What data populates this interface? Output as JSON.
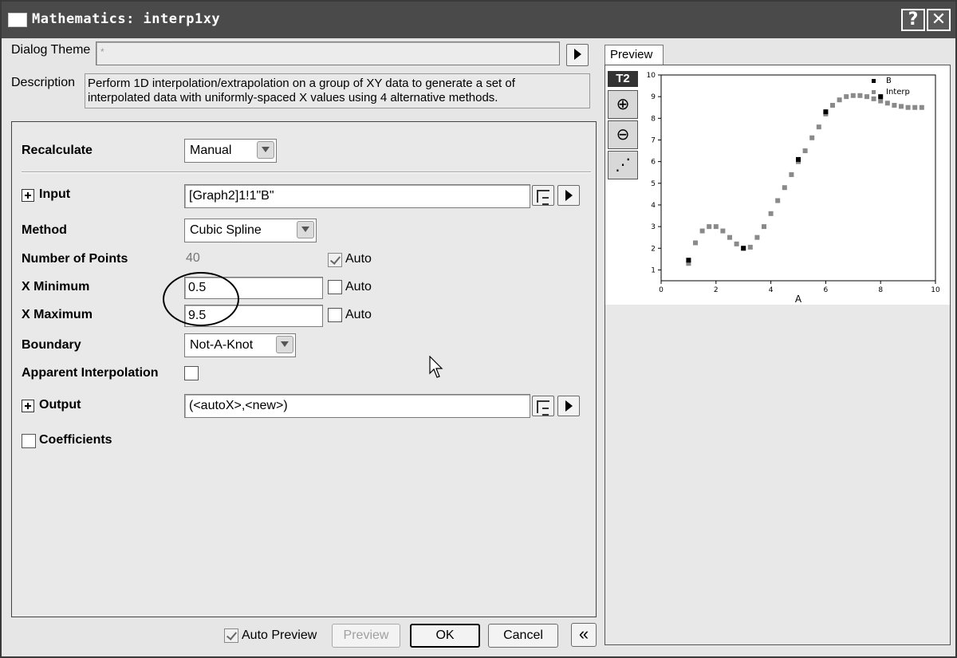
{
  "window": {
    "title": "Mathematics: interp1xy"
  },
  "titlebar": {
    "help_glyph": "?",
    "close_glyph": "✕"
  },
  "dialog_theme": {
    "label": "Dialog Theme",
    "value": "*"
  },
  "description": {
    "label": "Description",
    "text_line1": "Perform 1D interpolation/extrapolation on a group of XY data to generate a set of",
    "text_line2": "interpolated data with uniformly-spaced X values using 4 alternative methods."
  },
  "form": {
    "recalculate": {
      "label": "Recalculate",
      "value": "Manual"
    },
    "input": {
      "label": "Input",
      "value": "[Graph2]1!1\"B\""
    },
    "method": {
      "label": "Method",
      "value": "Cubic Spline"
    },
    "num_points": {
      "label": "Number of Points",
      "value": "40",
      "auto_label": "Auto",
      "auto_checked": true
    },
    "x_min": {
      "label": "X Minimum",
      "value": "0.5",
      "auto_label": "Auto",
      "auto_checked": false
    },
    "x_max": {
      "label": "X Maximum",
      "value": "9.5",
      "auto_label": "Auto",
      "auto_checked": false
    },
    "boundary": {
      "label": "Boundary",
      "value": "Not-A-Knot"
    },
    "apparent": {
      "label": "Apparent  Interpolation",
      "checked": false
    },
    "output": {
      "label": "Output",
      "value": "(<autoX>,<new>)"
    },
    "coefficients": {
      "label": "Coefficients",
      "checked": false
    }
  },
  "footer": {
    "auto_preview_label": "Auto Preview",
    "auto_preview_checked": true,
    "preview_label": "Preview",
    "ok_label": "OK",
    "cancel_label": "Cancel",
    "collapse_glyph": "«"
  },
  "preview": {
    "tab_label": "Preview",
    "t2_label": "T2",
    "zoom_in_glyph": "⊕",
    "zoom_out_glyph": "⊖",
    "rescale_glyph": "⋰"
  },
  "chart_data": {
    "type": "scatter",
    "xlabel": "A",
    "ylabel": "",
    "xlim": [
      0,
      10
    ],
    "ylim": [
      0.5,
      10
    ],
    "xticks": [
      0,
      2,
      4,
      6,
      8,
      10
    ],
    "yticks": [
      1,
      2,
      3,
      4,
      5,
      6,
      7,
      8,
      9,
      10
    ],
    "legend_position": "top-right",
    "series": [
      {
        "name": "B",
        "marker": "square",
        "color": "#000000",
        "x": [
          1,
          3,
          5,
          6,
          8
        ],
        "y": [
          1.45,
          2.0,
          6.1,
          8.3,
          9.0
        ]
      },
      {
        "name": "Interp",
        "marker": "square",
        "color": "#8a8a8a",
        "x": [
          1.0,
          1.25,
          1.5,
          1.75,
          2.0,
          2.25,
          2.5,
          2.75,
          3.0,
          3.25,
          3.5,
          3.75,
          4.0,
          4.25,
          4.5,
          4.75,
          5.0,
          5.25,
          5.5,
          5.75,
          6.0,
          6.25,
          6.5,
          6.75,
          7.0,
          7.25,
          7.5,
          7.75,
          8.0,
          8.25,
          8.5,
          8.75,
          9.0,
          9.25,
          9.5
        ],
        "y": [
          1.3,
          2.25,
          2.8,
          3.0,
          3.0,
          2.8,
          2.5,
          2.2,
          2.0,
          2.05,
          2.5,
          3.0,
          3.6,
          4.2,
          4.8,
          5.4,
          6.0,
          6.5,
          7.1,
          7.6,
          8.2,
          8.6,
          8.85,
          9.0,
          9.05,
          9.05,
          9.0,
          8.9,
          8.8,
          8.7,
          8.6,
          8.55,
          8.5,
          8.5,
          8.5
        ]
      }
    ]
  }
}
